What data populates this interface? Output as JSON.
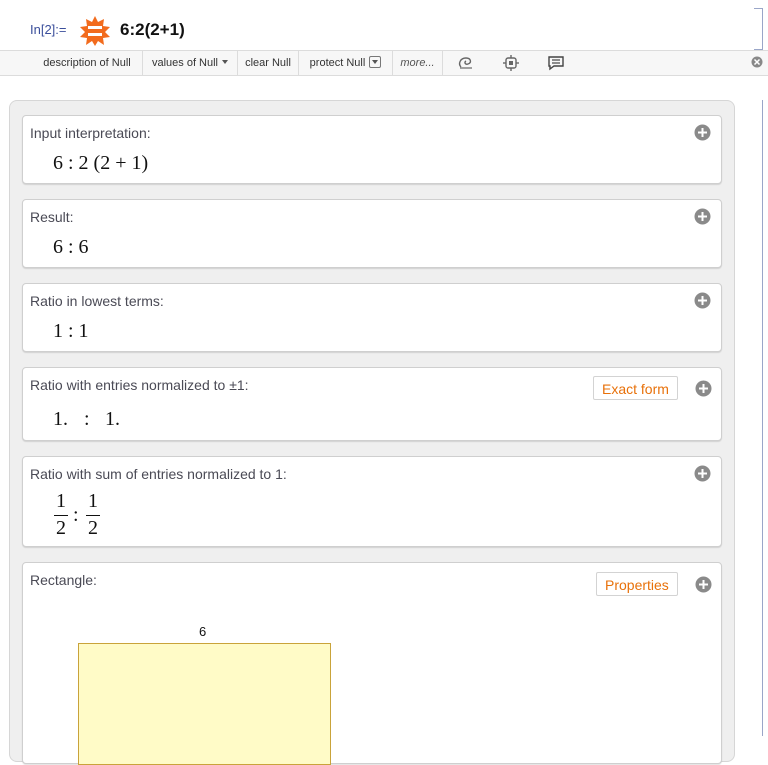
{
  "input_line": {
    "prompt": "In[2]:=",
    "query": "6:2(2+1)"
  },
  "toolbar": {
    "items": [
      {
        "label": "description of Null"
      },
      {
        "label": "values of Null"
      },
      {
        "label": "clear Null"
      },
      {
        "label": "protect Null"
      },
      {
        "label": "more..."
      }
    ]
  },
  "pods": [
    {
      "title": "Input interpretation:",
      "content": "6 : 2 (2 + 1)"
    },
    {
      "title": "Result:",
      "content": "6 : 6"
    },
    {
      "title": "Ratio in lowest terms:",
      "content": "1 : 1"
    },
    {
      "title": "Ratio with entries normalized to ±1:",
      "content_left": "1.",
      "content_sep": ":",
      "content_right": "1.",
      "button": "Exact form"
    },
    {
      "title": "Ratio with sum of entries normalized to 1:",
      "frac_num": "1",
      "frac_den": "2",
      "frac_sep": ":"
    },
    {
      "title": "Rectangle:",
      "button": "Properties",
      "width_label": "6"
    }
  ],
  "colors": {
    "accent": "#e8710a",
    "prompt": "#3a4e9b",
    "rect_fill": "#fffbc7",
    "rect_stroke": "#c9a33a"
  }
}
